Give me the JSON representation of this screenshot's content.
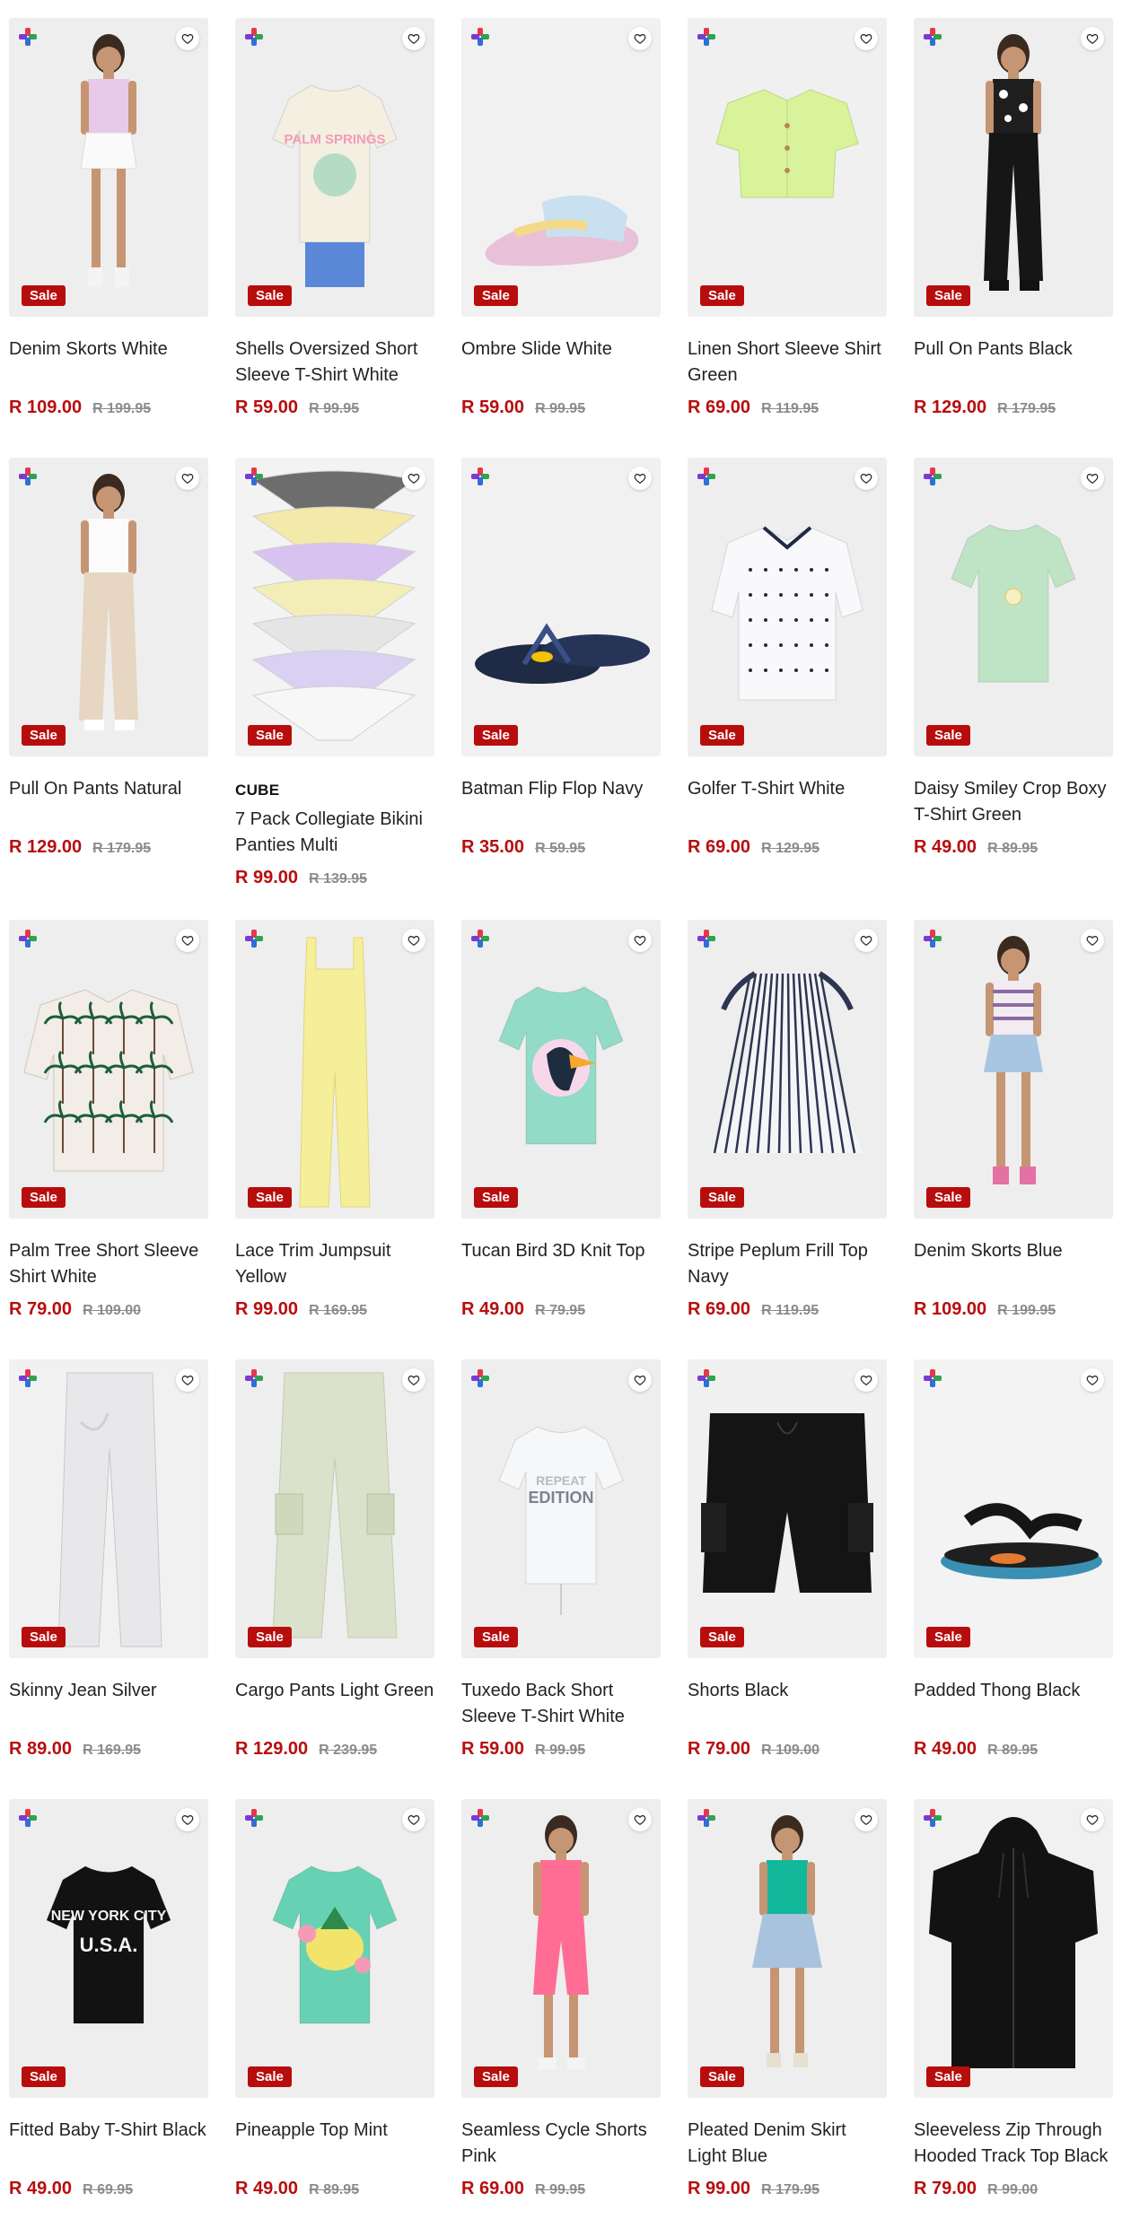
{
  "sale_label": "Sale",
  "colors": {
    "accent": "#b80d0d",
    "image_bg": "#eeeeee"
  },
  "icons": {
    "corner": "plus-logo-icon",
    "wishlist": "heart-icon"
  },
  "rows": [
    [
      {
        "name": "Denim Skorts White",
        "price": "R 109.00",
        "was": "R 199.95",
        "art": "kid-white-skort"
      },
      {
        "name": "Shells Oversized Short Sleeve T-Shirt White",
        "price": "R 59.00",
        "was": "R 99.95",
        "art": "kid-cream-tee"
      },
      {
        "name": "Ombre Slide White",
        "price": "R 59.00",
        "was": "R 99.95",
        "art": "slide"
      },
      {
        "name": "Linen Short Sleeve Shirt Green",
        "price": "R 69.00",
        "was": "R 119.95",
        "art": "green-shirt"
      },
      {
        "name": "Pull On Pants Black",
        "price": "R 129.00",
        "was": "R 179.95",
        "art": "kid-black-pants"
      }
    ],
    [
      {
        "name": "Pull On Pants Natural",
        "price": "R 129.00",
        "was": "R 179.95",
        "art": "kid-natural-pants"
      },
      {
        "brand": "CUBE",
        "name": "7 Pack Collegiate Bikini Panties Multi",
        "price": "R 99.00",
        "was": "R 139.95",
        "art": "panties"
      },
      {
        "name": "Batman Flip Flop Navy",
        "price": "R 35.00",
        "was": "R 59.95",
        "art": "flipflop-navy"
      },
      {
        "name": "Golfer T-Shirt White",
        "price": "R 69.00",
        "was": "R 129.95",
        "art": "golfer"
      },
      {
        "name": "Daisy Smiley Crop Boxy T-Shirt Green",
        "price": "R 49.00",
        "was": "R 89.95",
        "art": "green-crop"
      }
    ],
    [
      {
        "name": "Palm Tree Short Sleeve Shirt White",
        "price": "R 79.00",
        "was": "R 109.00",
        "art": "palm-shirt"
      },
      {
        "name": "Lace Trim Jumpsuit Yellow",
        "price": "R 99.00",
        "was": "R 169.95",
        "art": "jumpsuit"
      },
      {
        "name": "Tucan Bird 3D Knit Top",
        "price": "R 49.00",
        "was": "R 79.95",
        "art": "tucan-top"
      },
      {
        "name": "Stripe Peplum Frill Top Navy",
        "price": "R 69.00",
        "was": "R 119.95",
        "art": "peplum"
      },
      {
        "name": "Denim Skorts Blue",
        "price": "R 109.00",
        "was": "R 199.95",
        "art": "kid-blue-skort"
      }
    ],
    [
      {
        "name": "Skinny Jean Silver",
        "price": "R 89.00",
        "was": "R 169.95",
        "art": "silver-jean"
      },
      {
        "name": "Cargo Pants Light Green",
        "price": "R 129.00",
        "was": "R 239.95",
        "art": "cargo"
      },
      {
        "name": "Tuxedo Back Short Sleeve T-Shirt White",
        "price": "R 59.00",
        "was": "R 99.95",
        "art": "edition-tee"
      },
      {
        "name": "Shorts Black",
        "price": "R 79.00",
        "was": "R 109.00",
        "art": "black-shorts"
      },
      {
        "name": "Padded Thong Black",
        "price": "R 49.00",
        "was": "R 89.95",
        "art": "thong"
      }
    ],
    [
      {
        "name": "Fitted Baby T-Shirt Black",
        "price": "R 49.00",
        "was": "R 69.95",
        "art": "nyc-tee"
      },
      {
        "name": "Pineapple Top Mint",
        "price": "R 49.00",
        "was": "R 89.95",
        "art": "pineapple-top"
      },
      {
        "name": "Seamless Cycle Shorts Pink",
        "price": "R 69.00",
        "was": "R 99.95",
        "art": "kid-pink"
      },
      {
        "name": "Pleated Denim Skirt Light Blue",
        "price": "R 99.00",
        "was": "R 179.95",
        "art": "kid-teal"
      },
      {
        "name": "Sleeveless Zip Through Hooded Track Top Black",
        "price": "R 79.00",
        "was": "R 99.00",
        "art": "black-hoodie"
      }
    ]
  ]
}
